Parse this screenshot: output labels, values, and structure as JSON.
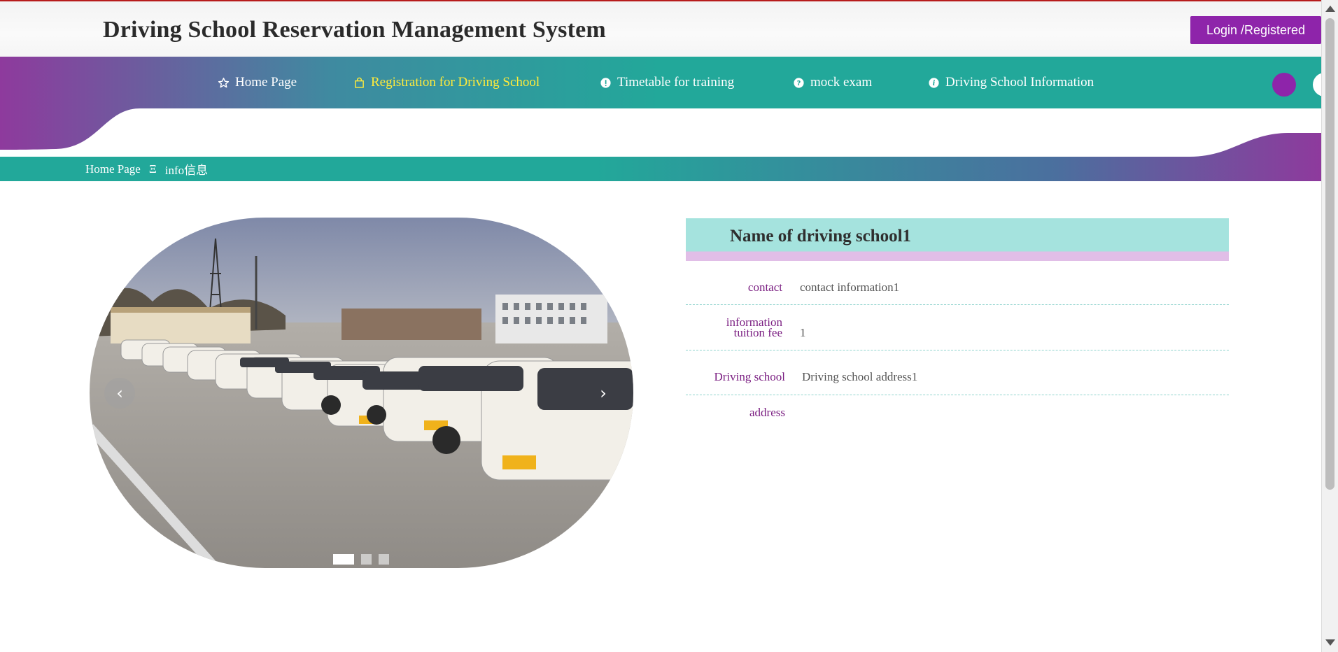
{
  "header": {
    "title": "Driving School Reservation Management System",
    "login_label": "Login /Registered"
  },
  "nav": {
    "items": [
      {
        "label": "Home Page",
        "icon": "star-outline-icon"
      },
      {
        "label": "Registration for Driving School",
        "icon": "shopping-bag-icon",
        "active": true
      },
      {
        "label": "Timetable for training",
        "icon": "exclamation-circle-icon"
      },
      {
        "label": "mock exam",
        "icon": "question-circle-icon"
      },
      {
        "label": "Driving School Information",
        "icon": "info-circle-icon"
      }
    ]
  },
  "breadcrumb": {
    "home": "Home Page",
    "separator": "Ξ",
    "current": "info信息"
  },
  "carousel": {
    "prev": "‹",
    "next": "›",
    "slide_count": 3,
    "active_slide": 1
  },
  "detail": {
    "title": "Name of driving school1",
    "contact_label": "contact",
    "contact_value": "contact information1",
    "fee_label_line1": "information",
    "fee_label_line2": "tuition fee",
    "fee_value": "1",
    "address_label_line1": "Driving school",
    "address_label_line2": "address",
    "address_value": "Driving school address1"
  },
  "colors": {
    "purple": "#8e24aa",
    "teal": "#26a69a",
    "active_nav": "#ffeb3b"
  }
}
